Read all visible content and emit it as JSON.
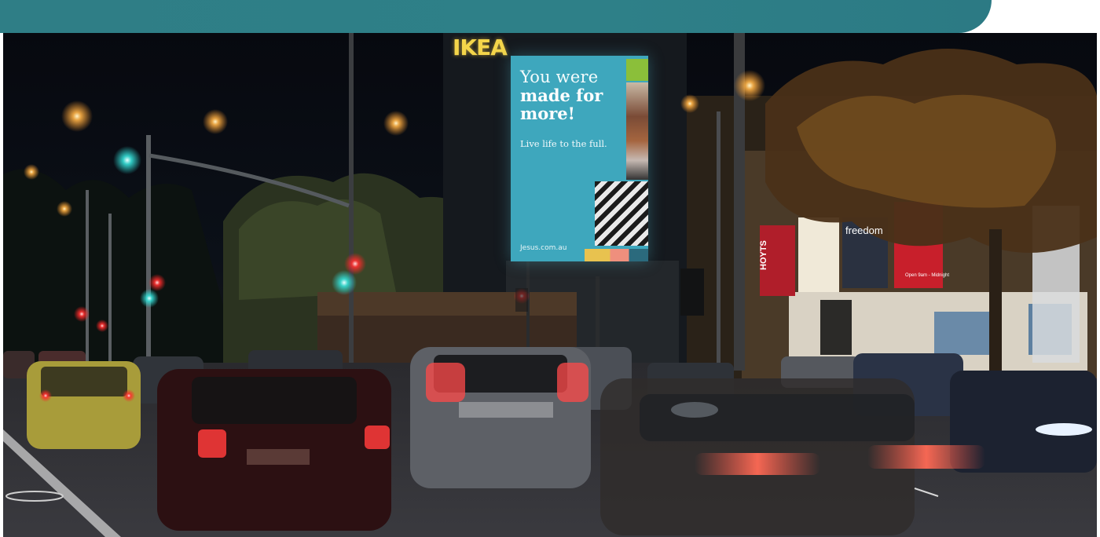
{
  "billboard": {
    "line1": "You were",
    "line2a": "made for",
    "line2b": "more!",
    "tagline": "Live life to the full.",
    "url": "Jesus.com.au",
    "colors": {
      "background": "#3ea7bd",
      "accent_green": "#8bbf3a"
    }
  },
  "signs": {
    "ikea": "IKEA",
    "hoyts": "HOYTS",
    "freedom": "freedom",
    "open": "Open 9am - Midnight"
  },
  "colors": {
    "banner": "#2e8088",
    "sky": "#07090f"
  }
}
